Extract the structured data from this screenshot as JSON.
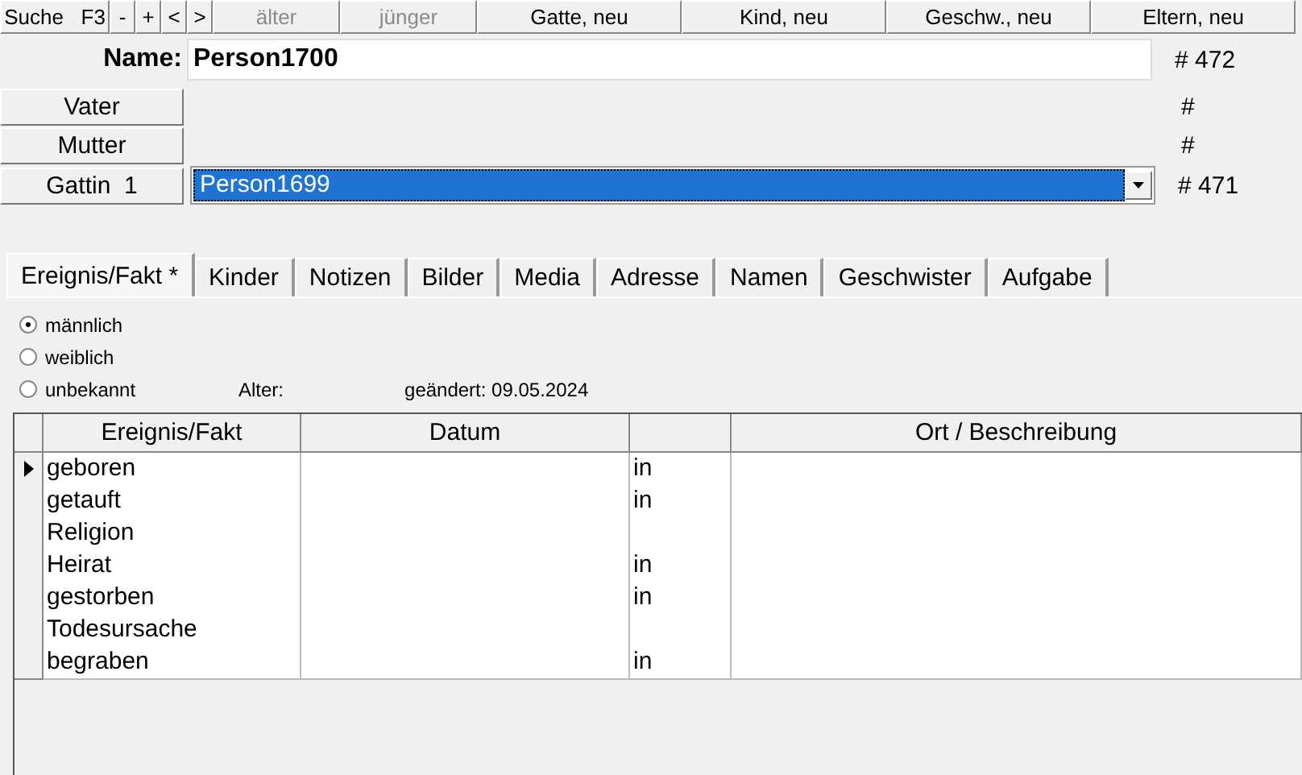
{
  "toolbar": [
    {
      "label": "Suche   F3",
      "disabled": false,
      "kind": "wide"
    },
    {
      "label": "-",
      "disabled": false,
      "kind": "small"
    },
    {
      "label": "+",
      "disabled": false,
      "kind": "small"
    },
    {
      "label": "<",
      "disabled": false,
      "kind": "small"
    },
    {
      "label": ">",
      "disabled": false,
      "kind": "small"
    },
    {
      "label": "älter",
      "disabled": true,
      "kind": "mid"
    },
    {
      "label": "jünger",
      "disabled": true,
      "kind": "mid2"
    },
    {
      "label": "Gatte, neu",
      "disabled": false,
      "kind": "big"
    },
    {
      "label": "Kind, neu",
      "disabled": false,
      "kind": "big"
    },
    {
      "label": "Geschw., neu",
      "disabled": false,
      "kind": "big"
    },
    {
      "label": "Eltern, neu",
      "disabled": false,
      "kind": "big"
    }
  ],
  "name": {
    "label": "Name:",
    "value": "Person1700",
    "number": "# 472"
  },
  "relations": [
    {
      "label": "Vater",
      "kind": "empty",
      "number": "#"
    },
    {
      "label": "Mutter",
      "kind": "empty",
      "number": "#"
    },
    {
      "label": "Gattin  1",
      "kind": "combo",
      "value": "Person1699",
      "number": "# 471"
    }
  ],
  "tabs": [
    {
      "label": "Ereignis/Fakt *",
      "selected": true
    },
    {
      "label": "Kinder",
      "selected": false
    },
    {
      "label": "Notizen",
      "selected": false
    },
    {
      "label": "Bilder",
      "selected": false
    },
    {
      "label": "Media",
      "selected": false
    },
    {
      "label": "Adresse",
      "selected": false
    },
    {
      "label": "Namen",
      "selected": false
    },
    {
      "label": "Geschwister",
      "selected": false
    },
    {
      "label": "Aufgabe",
      "selected": false
    }
  ],
  "gender": [
    {
      "label": "männlich",
      "selected": true
    },
    {
      "label": "weiblich",
      "selected": false
    },
    {
      "label": "unbekannt",
      "selected": false
    }
  ],
  "age_label": "Alter:",
  "changed": "geändert: 09.05.2024",
  "table": {
    "columns": [
      "Ereignis/Fakt",
      "Datum",
      "",
      "Ort / Beschreibung"
    ],
    "rows": [
      {
        "event": "geboren",
        "prep": "in",
        "selected": true
      },
      {
        "event": "getauft",
        "prep": "in",
        "selected": false
      },
      {
        "event": "Religion",
        "selected": false
      },
      {
        "event": "Heirat",
        "prep": "in",
        "selected": false
      },
      {
        "event": "gestorben",
        "prep": "in",
        "selected": false
      },
      {
        "event": "Todesursache",
        "selected": false
      },
      {
        "event": "begraben",
        "prep": "in",
        "selected": false
      }
    ]
  }
}
